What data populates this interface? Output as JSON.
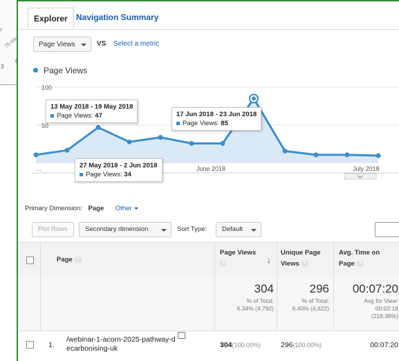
{
  "background_fragment": {
    "texts": [
      "in",
      "75 min",
      "6",
      "3"
    ]
  },
  "tabs": {
    "explorer": "Explorer",
    "navigation_summary": "Navigation Summary"
  },
  "metric_selector": {
    "value": "Page Views",
    "vs": "VS",
    "select_metric": "Select a metric"
  },
  "legend": {
    "label": "Page Views"
  },
  "chart_data": {
    "type": "area",
    "series": [
      {
        "name": "Page Views",
        "values": [
          11,
          17,
          47,
          28,
          34,
          26,
          26,
          85,
          16,
          11,
          11,
          10
        ]
      }
    ],
    "x_labels": [
      "...",
      "June 2018",
      "July 2018"
    ],
    "y_ticks": [
      50,
      100
    ],
    "ylim": [
      0,
      100
    ],
    "color": "#3b8ecf",
    "fill_color": "#dbe9f7",
    "highlighted_index": 7
  },
  "tooltips": [
    {
      "range": "13 May 2018 - 19 May 2018",
      "metric": "Page Views:",
      "value": "47"
    },
    {
      "range": "17 Jun 2018 - 23 Jun 2018",
      "metric": "Page Views:",
      "value": "85"
    },
    {
      "range": "27 May 2018 - 2 Jun 2018",
      "metric": "Page Views:",
      "value": "34"
    }
  ],
  "dimension_row": {
    "label": "Primary Dimension:",
    "value": "Page",
    "other": "Other"
  },
  "toolbar": {
    "plot_rows": "Plot Rows",
    "secondary_dimension": "Secondary dimension",
    "sort_type_label": "Sort Type:",
    "sort_type_value": "Default"
  },
  "table": {
    "headers": {
      "page": "Page",
      "page_views_1": "Page Views",
      "unique_1": "Unique Page",
      "unique_2": "Views",
      "avg_1": "Avg. Time on",
      "avg_2": "Page"
    },
    "totals": {
      "page_views": "304",
      "page_views_pct_1": "% of Total:",
      "page_views_pct_2": "6.34% (4,792)",
      "unique": "296",
      "unique_pct_1": "% of Total:",
      "unique_pct_2": "6.40% (4,622)",
      "avg_time": "00:07:20",
      "avg_sub_1": "Avg for View:",
      "avg_sub_2": "00:02:18",
      "avg_sub_3": "(218.38%)"
    },
    "rows": [
      {
        "index": "1.",
        "page_line1": "/webinar-1-acorn-2025-pathway-d",
        "page_line2": "ecarbonising-uk",
        "page_views": "304",
        "page_views_pct": "(100.00%)",
        "unique": "296",
        "unique_pct": "(100.00%)",
        "avg_time": "00:07:20"
      }
    ]
  }
}
